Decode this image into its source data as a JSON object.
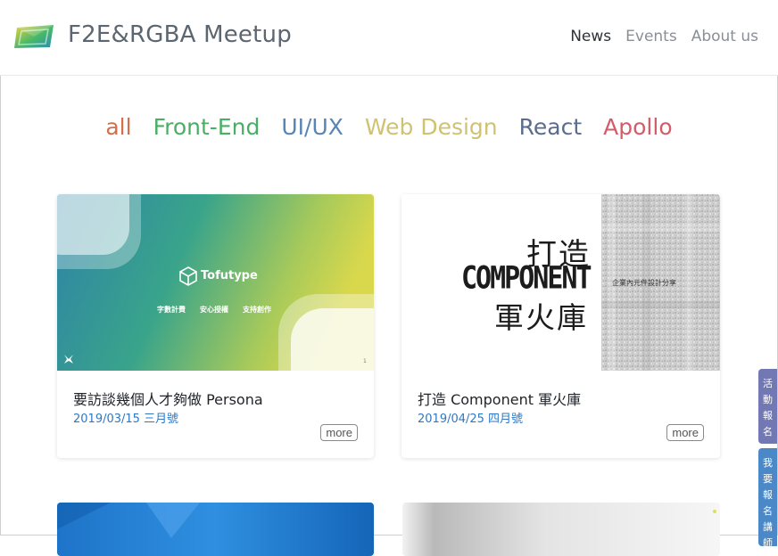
{
  "header": {
    "brand": "F2E&RGBA Meetup",
    "nav": [
      {
        "label": "News",
        "active": true
      },
      {
        "label": "Events",
        "active": false
      },
      {
        "label": "About us",
        "active": false
      }
    ]
  },
  "categories": [
    {
      "label": "all",
      "color": "#d2704a"
    },
    {
      "label": "Front-End",
      "color": "#4aae64"
    },
    {
      "label": "UI/UX",
      "color": "#5885b6"
    },
    {
      "label": "Web Design",
      "color": "#cfc272"
    },
    {
      "label": "React",
      "color": "#5a6d8e"
    },
    {
      "label": "Apollo",
      "color": "#d45b69"
    }
  ],
  "cards": [
    {
      "title": "要訪談幾個人才夠做 Persona",
      "date": "2019/03/15 三月號",
      "more": "more",
      "thumb": {
        "brand": "Tofutype",
        "tags": [
          "字數計費",
          "安心授權",
          "支持創作"
        ],
        "page": "1"
      }
    },
    {
      "title": "打造 Component 軍火庫",
      "date": "2019/04/25 四月號",
      "more": "more",
      "thumb": {
        "line1": "打造",
        "line2": "COMPONENT",
        "line3": "軍火庫",
        "sub": "企業內元件設計分享"
      }
    }
  ],
  "side_tabs": [
    {
      "label": "活動報名",
      "color": "#7278b4"
    },
    {
      "label": "我要報名講師",
      "color": "#4a88c8"
    }
  ],
  "colors": {
    "accent": "#2f78c4"
  }
}
